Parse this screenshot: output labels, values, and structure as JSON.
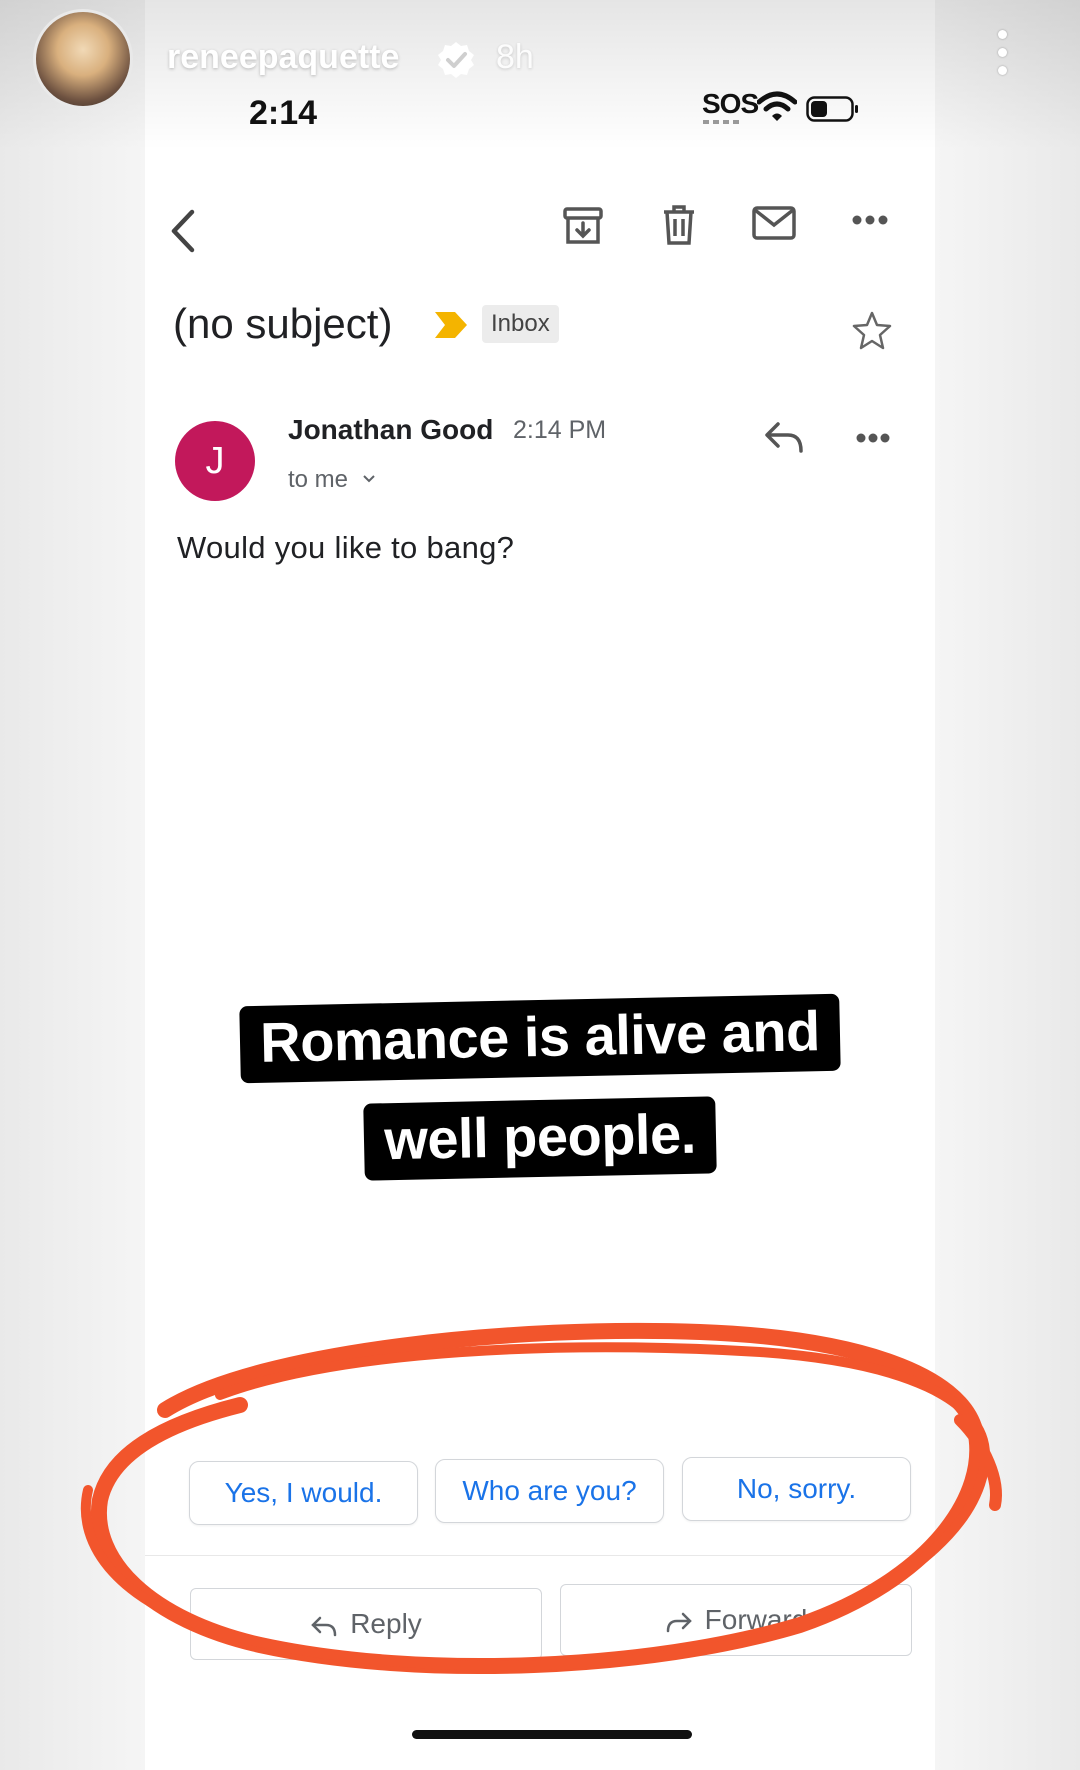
{
  "story": {
    "username": "reneepaquette",
    "age": "8h",
    "caption_line1": "Romance is alive and",
    "caption_line2": "well people."
  },
  "status_bar": {
    "time": "2:14",
    "carrier": "SOS"
  },
  "email": {
    "subject": "(no subject)",
    "label": "Inbox",
    "sender_initial": "J",
    "sender_name": "Jonathan Good",
    "sent_time": "2:14 PM",
    "recipient": "to me",
    "body": "Would you like to bang?"
  },
  "smart_replies": [
    "Yes, I would.",
    "Who are you?",
    "No, sorry."
  ],
  "actions": {
    "reply": "Reply",
    "forward": "Forward"
  },
  "colors": {
    "avatar": "#c2185b",
    "importance_marker": "#f4b400",
    "link_blue": "#1a73e8",
    "annotation_red": "#f2552c"
  }
}
